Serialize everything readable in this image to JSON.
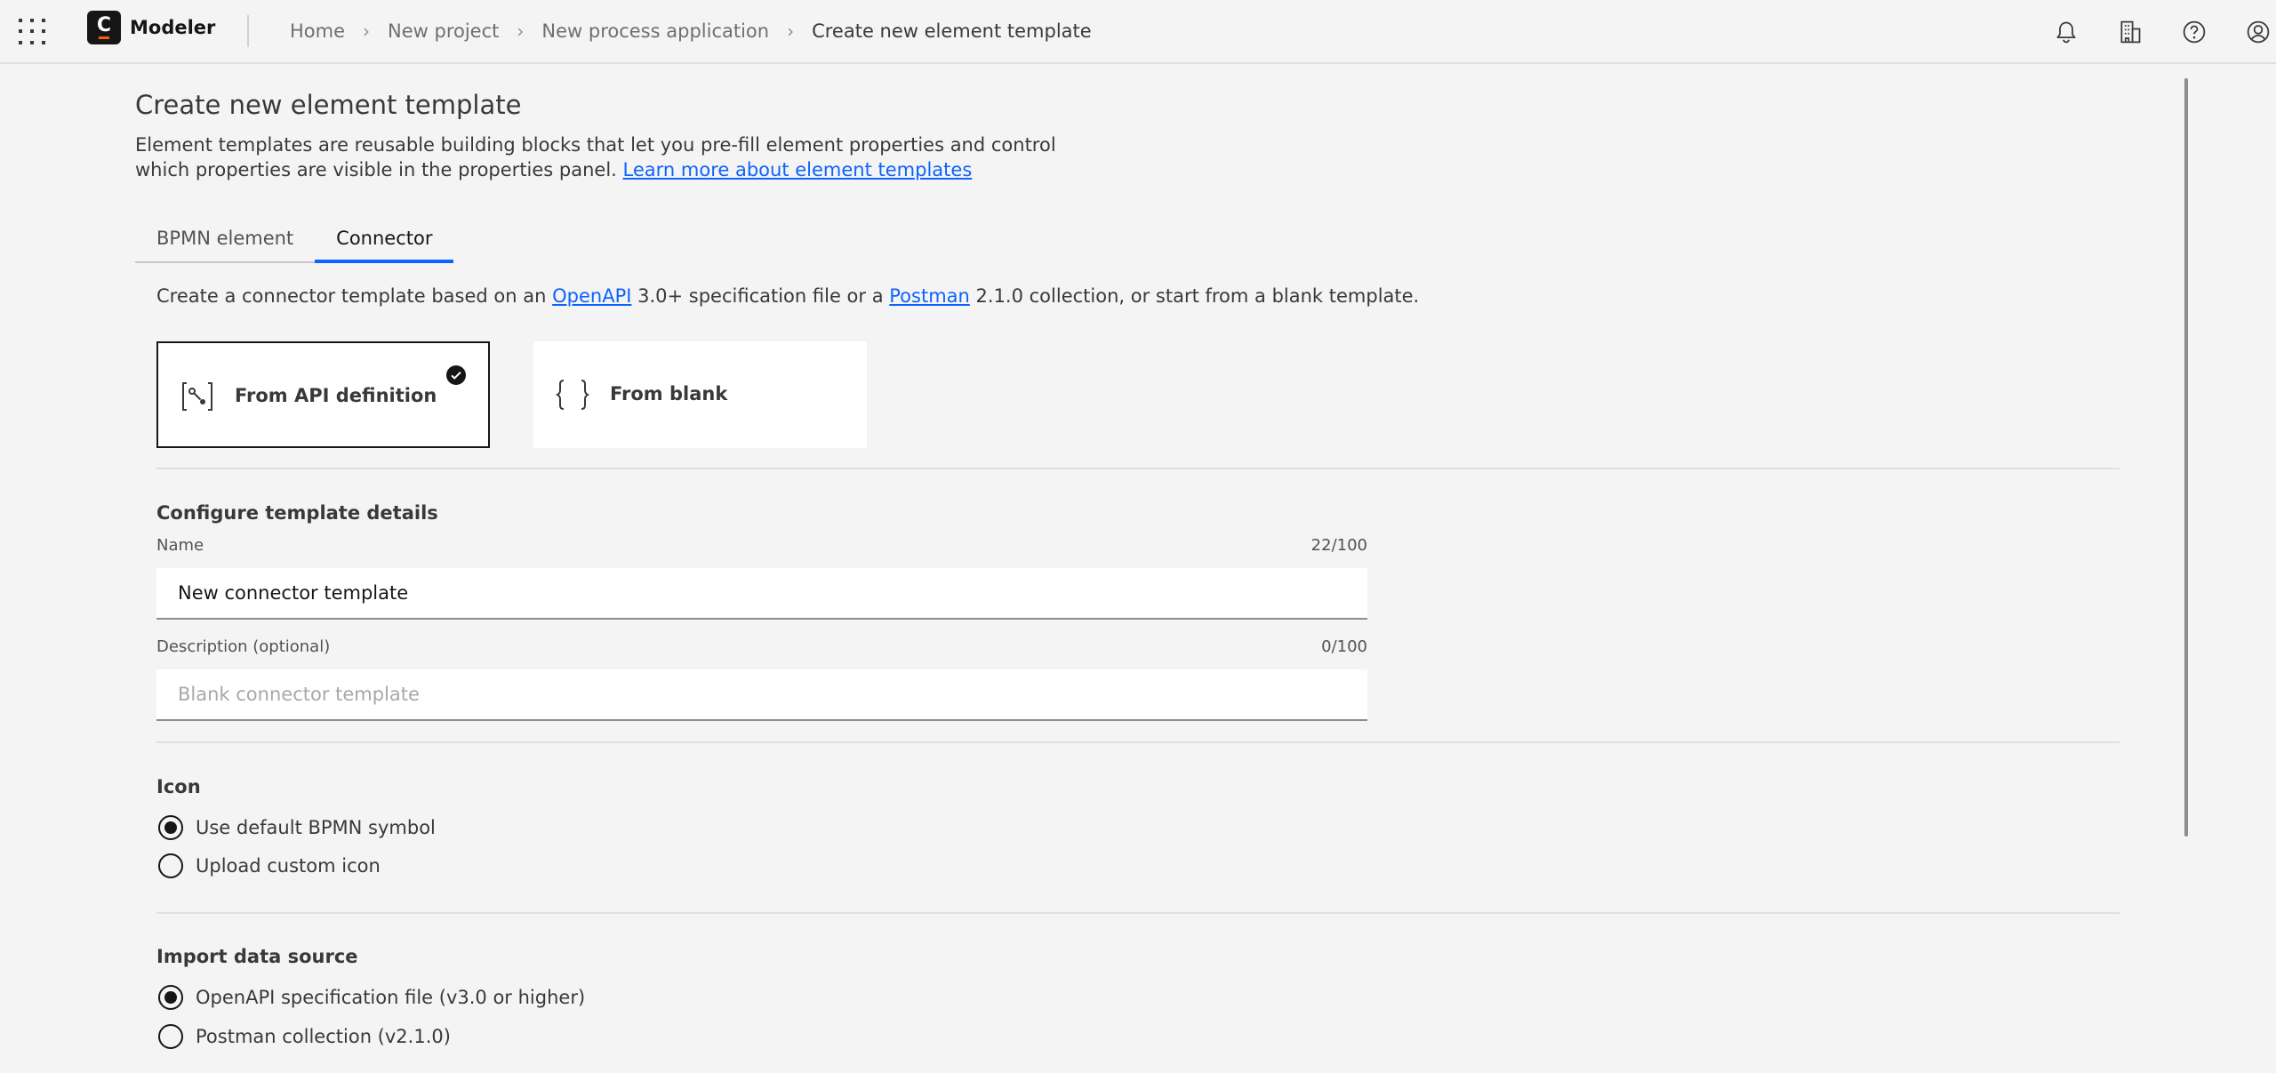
{
  "header": {
    "brand": "Modeler",
    "logo_letter": "C",
    "breadcrumbs": [
      "Home",
      "New project",
      "New process application"
    ],
    "current": "Create new element template",
    "icons": [
      "notification-icon",
      "organization-icon",
      "help-icon",
      "user-icon"
    ]
  },
  "page": {
    "title": "Create new element template",
    "intro_text": "Element templates are reusable building blocks that let you pre-fill element properties and control which properties are visible in the properties panel.",
    "intro_link": "Learn more about element templates"
  },
  "tabs": [
    {
      "label": "BPMN element",
      "active": false
    },
    {
      "label": "Connector",
      "active": true
    }
  ],
  "connector": {
    "desc_prefix": "Create a connector template based on an",
    "openapi_link": "OpenAPI",
    "desc_middle": "3.0+ specification file or a",
    "postman_link": "Postman",
    "desc_suffix": "2.1.0 collection, or start from a blank template.",
    "tiles": [
      {
        "label": "From API definition",
        "selected": true,
        "icon": "api-definition-icon"
      },
      {
        "label": "From blank",
        "selected": false,
        "icon": "curly-braces-icon"
      }
    ]
  },
  "details": {
    "title": "Configure template details",
    "name_label": "Name",
    "name_counter": "22/100",
    "name_value": "New connector template",
    "desc_label": "Description (optional)",
    "desc_counter": "0/100",
    "desc_placeholder": "Blank connector template"
  },
  "icon_section": {
    "title": "Icon",
    "options": [
      {
        "label": "Use default BPMN symbol",
        "checked": true
      },
      {
        "label": "Upload custom icon",
        "checked": false
      }
    ]
  },
  "import_section": {
    "title": "Import data source",
    "options": [
      {
        "label": "OpenAPI specification file (v3.0 or higher)",
        "checked": true
      },
      {
        "label": "Postman collection (v2.1.0)",
        "checked": false
      }
    ]
  },
  "colors": {
    "accent": "#0f62fe",
    "background": "#f4f4f4",
    "text": "#161616",
    "logo_bar": "#fc5d0d"
  }
}
